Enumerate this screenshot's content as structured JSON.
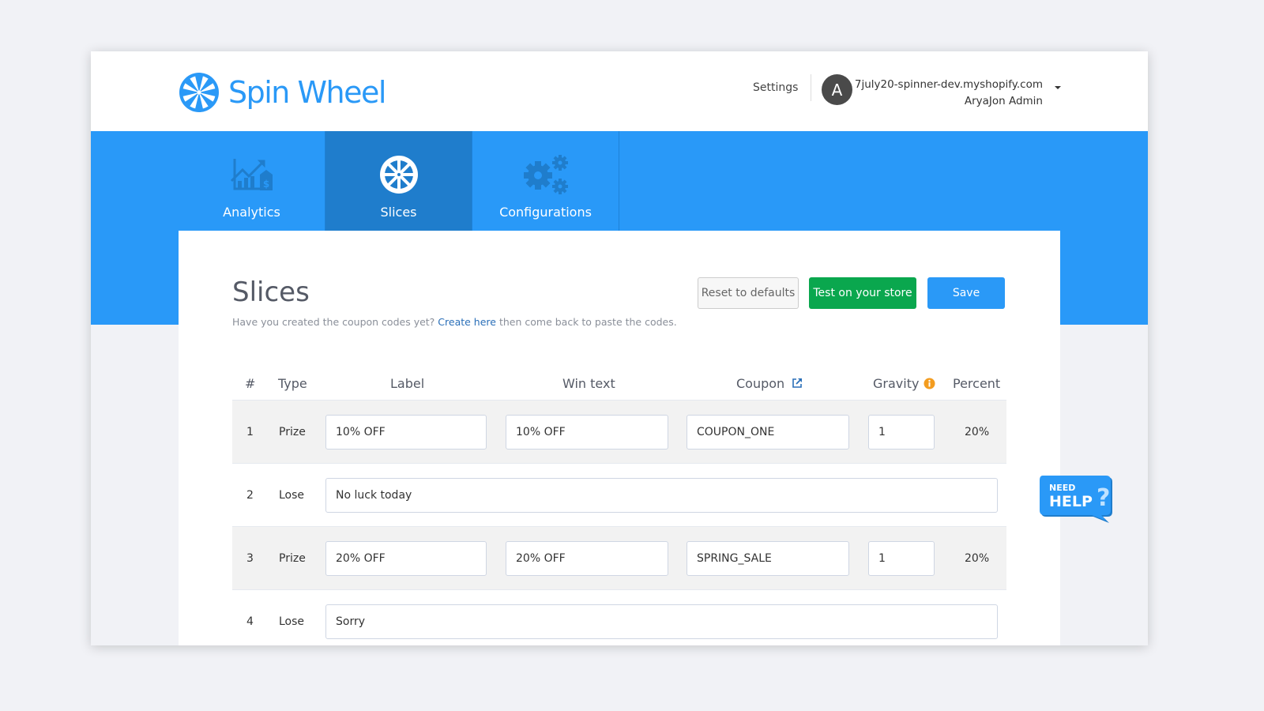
{
  "app": {
    "name": "Spin Wheel",
    "brand_color": "#2a99f7"
  },
  "header": {
    "settings_label": "Settings",
    "avatar_initial": "A",
    "store_domain": "7july20-spinner-dev.myshopify.com",
    "user_name": "AryaJon Admin"
  },
  "nav": {
    "tabs": [
      {
        "label": "Analytics",
        "icon": "analytics-icon",
        "active": false
      },
      {
        "label": "Slices",
        "icon": "wheel-icon",
        "active": true
      },
      {
        "label": "Configurations",
        "icon": "gears-icon",
        "active": false
      }
    ]
  },
  "page": {
    "title": "Slices",
    "hint_before": "Have you created the coupon codes yet? ",
    "hint_link": "Create here",
    "hint_after": " then come back to paste the codes."
  },
  "actions": {
    "reset_label": "Reset to defaults",
    "test_label": "Test on your store",
    "save_label": "Save"
  },
  "table": {
    "headers": {
      "num": "#",
      "type": "Type",
      "label": "Label",
      "win_text": "Win text",
      "coupon": "Coupon",
      "gravity": "Gravity",
      "percent": "Percent"
    },
    "rows": [
      {
        "num": "1",
        "type": "Prize",
        "label": "10% OFF",
        "win_text": "10% OFF",
        "coupon": "COUPON_ONE",
        "gravity": "1",
        "percent": "20%"
      },
      {
        "num": "2",
        "type": "Lose",
        "label": "No luck today"
      },
      {
        "num": "3",
        "type": "Prize",
        "label": "20% OFF",
        "win_text": "20% OFF",
        "coupon": "SPRING_SALE",
        "gravity": "1",
        "percent": "20%"
      },
      {
        "num": "4",
        "type": "Lose",
        "label": "Sorry"
      }
    ]
  },
  "help_widget": {
    "line1": "NEED",
    "line2": "HELP"
  }
}
